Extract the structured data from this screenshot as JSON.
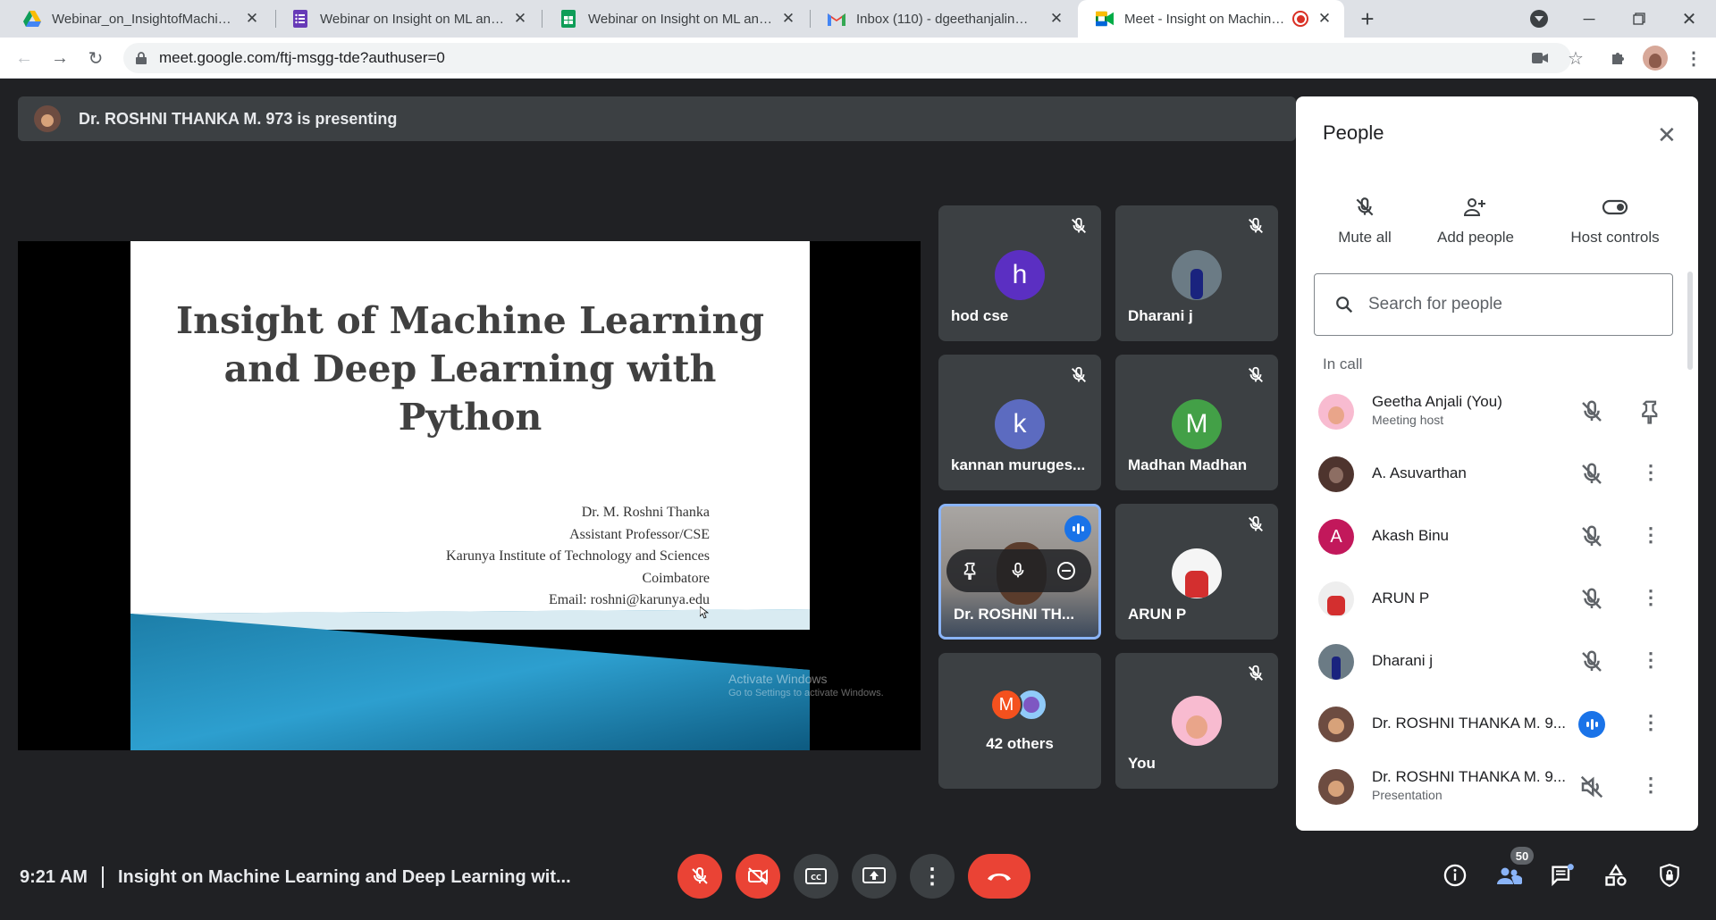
{
  "tabs": [
    {
      "title": "Webinar_on_InsightofMachineLe",
      "icon": "google-drive-icon"
    },
    {
      "title": "Webinar on Insight on ML and D",
      "icon": "google-forms-icon"
    },
    {
      "title": "Webinar on Insight on ML and D",
      "icon": "google-sheets-icon"
    },
    {
      "title": "Inbox (110) - dgeethanjalin@gm",
      "icon": "gmail-icon"
    },
    {
      "title": "Meet - Insight on Machine L",
      "icon": "google-meet-icon"
    }
  ],
  "browser": {
    "url": "meet.google.com/ftj-msgg-tde?authuser=0"
  },
  "presenting_bar": {
    "text": "Dr. ROSHNI THANKA M. 973 is presenting"
  },
  "slide": {
    "title_lines": [
      "Insight of Machine Learning",
      "and Deep Learning with",
      "Python"
    ],
    "info_lines": [
      "Dr. M. Roshni Thanka",
      "Assistant Professor/CSE",
      "Karunya Institute of Technology and Sciences",
      "Coimbatore",
      "Email: roshni@karunya.edu"
    ]
  },
  "watermark": {
    "title": "Activate Windows",
    "subtitle": "Go to Settings to activate Windows."
  },
  "tiles": [
    {
      "name": "hod cse",
      "initial": "h",
      "color": "#5b2fc2"
    },
    {
      "name": "Dharani j"
    },
    {
      "name": "kannan muruges...",
      "initial": "k",
      "color": "#5c6bc0"
    },
    {
      "name": "Madhan Madhan",
      "initial": "M",
      "color": "#43a047"
    },
    {
      "name": "Dr. ROSHNI TH..."
    },
    {
      "name": "ARUN P"
    },
    {
      "name": "42 others",
      "initial": "M",
      "color": "#f4511e"
    },
    {
      "name": "You"
    }
  ],
  "panel": {
    "title": "People",
    "actions": {
      "mute_all": "Mute all",
      "add_people": "Add people",
      "host_controls": "Host controls"
    },
    "search_placeholder": "Search for people",
    "section": "In call",
    "people": [
      {
        "name": "Geetha Anjali (You)",
        "subtitle": "Meeting host"
      },
      {
        "name": "A. Asuvarthan"
      },
      {
        "name": "Akash Binu",
        "initial": "A",
        "color": "#c2185b"
      },
      {
        "name": "ARUN P"
      },
      {
        "name": "Dharani j"
      },
      {
        "name": "Dr. ROSHNI THANKA M. 9..."
      },
      {
        "name": "Dr. ROSHNI THANKA M. 9...",
        "subtitle": "Presentation"
      }
    ]
  },
  "bottom_bar": {
    "time": "9:21 AM",
    "meeting_title": "Insight on Machine Learning and Deep Learning wit...",
    "participant_count": "50"
  }
}
